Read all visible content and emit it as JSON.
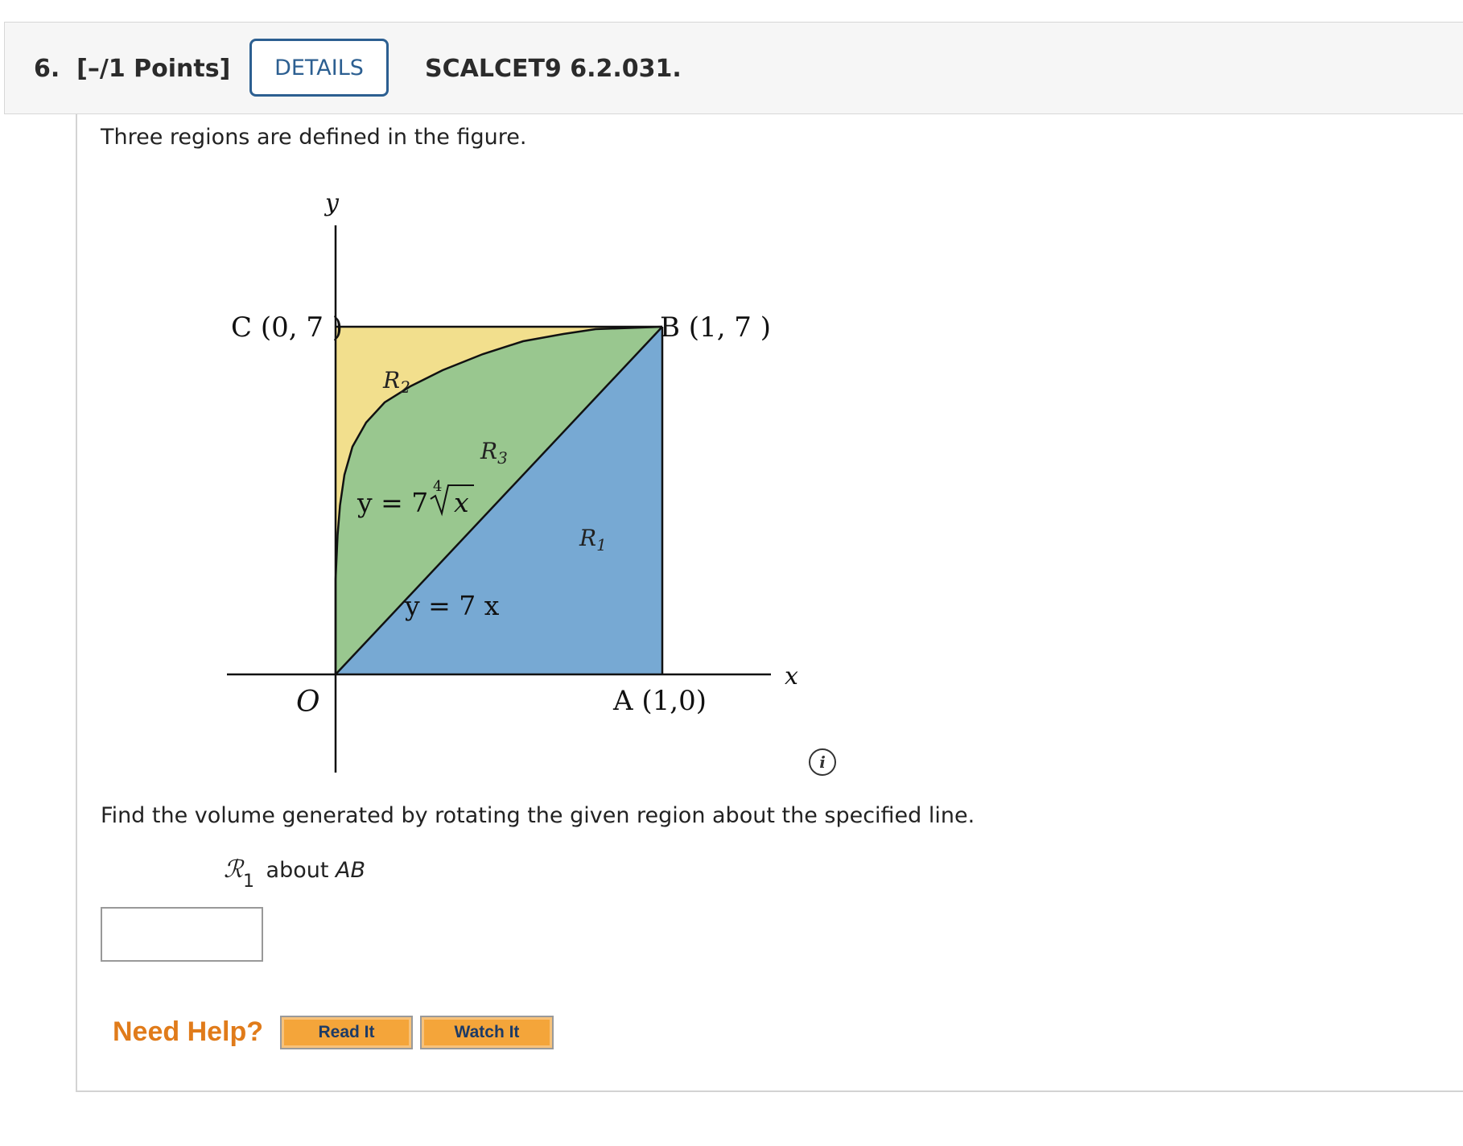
{
  "header": {
    "question_number": "6.",
    "points": "[–/1 Points]",
    "details_label": "DETAILS",
    "code": "SCALCET9 6.2.031."
  },
  "intro_text": "Three regions are defined in the figure.",
  "figure": {
    "y_axis_label": "y",
    "x_axis_label": "x",
    "origin_label": "O",
    "point_C": "C (0, 7 )",
    "point_B": "B (1, 7 )",
    "point_A": "A (1,0)",
    "region_R1": "R",
    "region_R1_sub": "1",
    "region_R2": "R",
    "region_R2_sub": "2",
    "region_R3": "R",
    "region_R3_sub": "3",
    "curve_label": "y = 7",
    "curve_root_index": "4",
    "curve_radicand": "x",
    "line_label": "y = 7 x",
    "colors": {
      "R1": "#77a9d3",
      "R2": "#f2df8d",
      "R3": "#99c78f"
    }
  },
  "info_icon": "i",
  "instruction_text": "Find the volume generated by rotating the given region about the specified line.",
  "subquestion": {
    "region": "ℛ",
    "region_sub": "1",
    "about": "about",
    "axis": "AB"
  },
  "answer": {
    "value": ""
  },
  "help": {
    "label": "Need Help?",
    "read_label": "Read It",
    "watch_label": "Watch It"
  }
}
